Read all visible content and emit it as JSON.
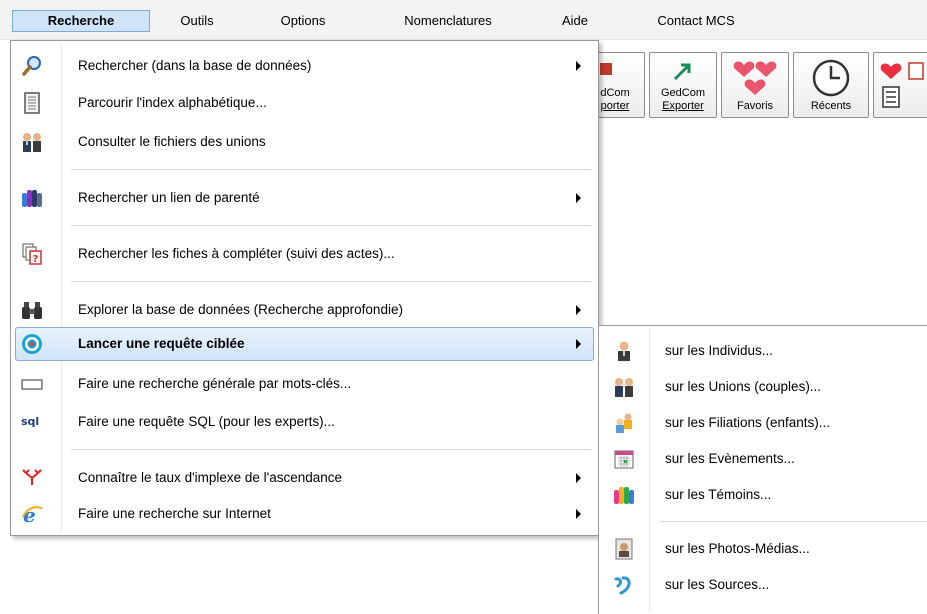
{
  "menubar": {
    "items": [
      "Recherche",
      "Outils",
      "Options",
      "Nomenclatures",
      "Aide",
      "Contact MCS"
    ]
  },
  "toolbar": {
    "gedcom_import": {
      "line1": "dCom",
      "line2": "porter"
    },
    "gedcom_export": {
      "line1": "GedCom",
      "line2": "Exporter"
    },
    "favoris": "Favoris",
    "recents": "Récents"
  },
  "menu": {
    "items": [
      {
        "label": "Rechercher (dans la base de données)",
        "icon": "magnifier-icon",
        "submenu": true
      },
      {
        "label": "Parcourir l'index alphabétique...",
        "icon": "document-list-icon",
        "submenu": false
      },
      {
        "label": "Consulter le fichiers des unions",
        "icon": "couple-icon",
        "submenu": false
      },
      {
        "label": "Rechercher un lien de parenté",
        "icon": "family-group-icon",
        "submenu": true
      },
      {
        "label": "Rechercher les fiches à compléter (suivi des actes)...",
        "icon": "pages-question-icon",
        "submenu": false
      },
      {
        "label": "Explorer la base de données (Recherche approfondie)",
        "icon": "binoculars-icon",
        "submenu": true
      },
      {
        "label": "Lancer une requête ciblée",
        "icon": "target-icon",
        "submenu": true
      },
      {
        "label": "Faire une recherche générale par mots-clés...",
        "icon": "textbox-icon",
        "submenu": false
      },
      {
        "label": "Faire une requête SQL (pour les experts)...",
        "icon": "sql-icon",
        "submenu": false,
        "icon_text": "sql"
      },
      {
        "label": "Connaître le taux d'implexe de l'ascendance",
        "icon": "pedigree-icon",
        "submenu": true
      },
      {
        "label": "Faire une recherche sur Internet",
        "icon": "internet-explorer-icon",
        "submenu": true
      }
    ]
  },
  "submenu": {
    "items": [
      {
        "label": "sur les Individus...",
        "icon": "person-icon"
      },
      {
        "label": "sur les Unions (couples)...",
        "icon": "couple-icon"
      },
      {
        "label": "sur les Filiations (enfants)...",
        "icon": "children-icon"
      },
      {
        "label": "sur les Evènements...",
        "icon": "calendar-icon"
      },
      {
        "label": "sur les Témoins...",
        "icon": "witnesses-icon"
      },
      {
        "label": "sur les Photos-Médias...",
        "icon": "photo-portrait-icon"
      },
      {
        "label": "sur les Sources...",
        "icon": "source-icon"
      }
    ]
  },
  "colors": {
    "highlight_bg": "#cfe4fa",
    "highlight_border": "#84acdd",
    "menubar_active": "#cfe3fb"
  }
}
